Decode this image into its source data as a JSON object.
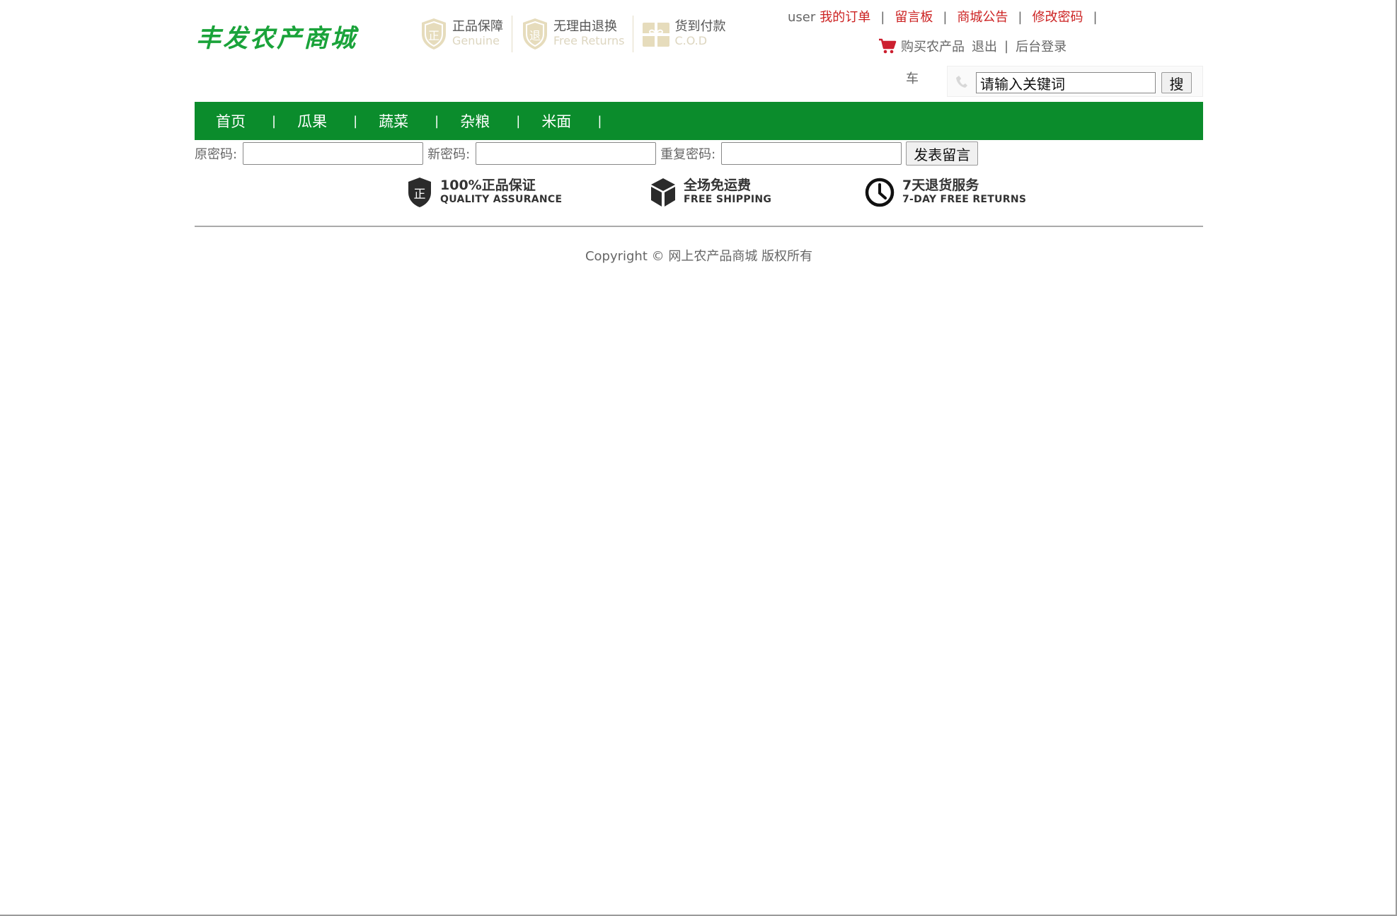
{
  "header": {
    "logo_text": "丰发农产商城",
    "promises": [
      {
        "title": "正品保障",
        "sub": "Genuine",
        "icon": "shield-zheng-icon",
        "icon_char": "正"
      },
      {
        "title": "无理由退换",
        "sub": "Free Returns",
        "icon": "shield-tui-icon",
        "icon_char": "退"
      },
      {
        "title": "货到付款",
        "sub": "C.O.D",
        "icon": "gift-icon"
      }
    ],
    "topnav": {
      "user": "user",
      "links": [
        "我的订单",
        "留言板",
        "商城公告",
        "修改密码"
      ],
      "separator": "|"
    },
    "cart": {
      "label": "购买农产品",
      "label_wrap": "车",
      "logout": "退出",
      "admin": "后台登录",
      "separator": "|"
    },
    "search": {
      "value": "请输入关键词",
      "button": "搜"
    }
  },
  "nav": {
    "items": [
      "首页",
      "瓜果",
      "蔬菜",
      "杂粮",
      "米面"
    ],
    "separator": "|"
  },
  "password_form": {
    "old_label": "原密码:",
    "new_label": "新密码:",
    "repeat_label": "重复密码:",
    "submit": "发表留言"
  },
  "services": [
    {
      "title": "100%正品保证",
      "sub": "QUALITY ASSURANCE",
      "icon": "shield-quality-icon",
      "icon_char": "正"
    },
    {
      "title": "全场免运费",
      "sub": "FREE SHIPPING",
      "icon": "box-icon"
    },
    {
      "title": "7天退货服务",
      "sub": "7-DAY FREE RETURNS",
      "icon": "clock-icon"
    }
  ],
  "footer": {
    "copyright": "Copyright © 网上农产品商城 版权所有"
  },
  "colors": {
    "brand_green": "#0b8c2c",
    "logo_green": "#1aa33a",
    "link_red": "#cc2222",
    "promise_tan": "#ddd6c0"
  }
}
